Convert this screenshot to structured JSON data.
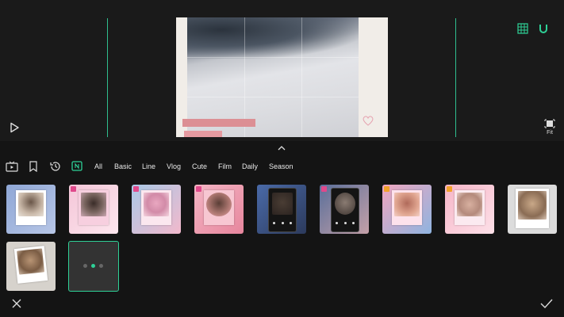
{
  "preview": {
    "icons": [
      "play-icon",
      "grid-icon",
      "magnet-icon",
      "fit-icon"
    ],
    "fit_label": "Fit"
  },
  "tabs": {
    "icons": [
      "tv-icon",
      "bookmark-icon",
      "history-icon",
      "new-icon"
    ],
    "categories": [
      "All",
      "Basic",
      "Line",
      "Vlog",
      "Cute",
      "Film",
      "Daily",
      "Season"
    ]
  },
  "thumbnails": [
    {
      "name": "template-1",
      "locked": false,
      "style": "polaroid-blue"
    },
    {
      "name": "template-2",
      "locked": true,
      "lock_color": "#e0498b",
      "style": "pink-frame"
    },
    {
      "name": "template-3",
      "locked": true,
      "lock_color": "#e0498b",
      "style": "blossom"
    },
    {
      "name": "template-4",
      "locked": true,
      "lock_color": "#e0498b",
      "style": "pink-circle"
    },
    {
      "name": "template-5",
      "locked": false,
      "style": "music-player-blue"
    },
    {
      "name": "template-6",
      "locked": true,
      "lock_color": "#e0498b",
      "style": "music-player-circle"
    },
    {
      "name": "template-7",
      "locked": true,
      "lock_color": "#f2a12a",
      "style": "pink-blue-gradient"
    },
    {
      "name": "template-8",
      "locked": true,
      "lock_color": "#f2a12a",
      "style": "pink-grid"
    },
    {
      "name": "template-9",
      "locked": false,
      "style": "white-polaroid"
    },
    {
      "name": "template-10",
      "locked": false,
      "style": "tilted-polaroids"
    },
    {
      "name": "template-11",
      "locked": false,
      "style": "selected-dark",
      "selected": true
    }
  ],
  "colors": {
    "accent": "#2ed197",
    "guide_line": "#2fbf8f",
    "lock_pink": "#e0498b",
    "lock_orange": "#f2a12a"
  },
  "actions": {
    "close_icon": "close-icon",
    "confirm_icon": "checkmark-icon"
  }
}
